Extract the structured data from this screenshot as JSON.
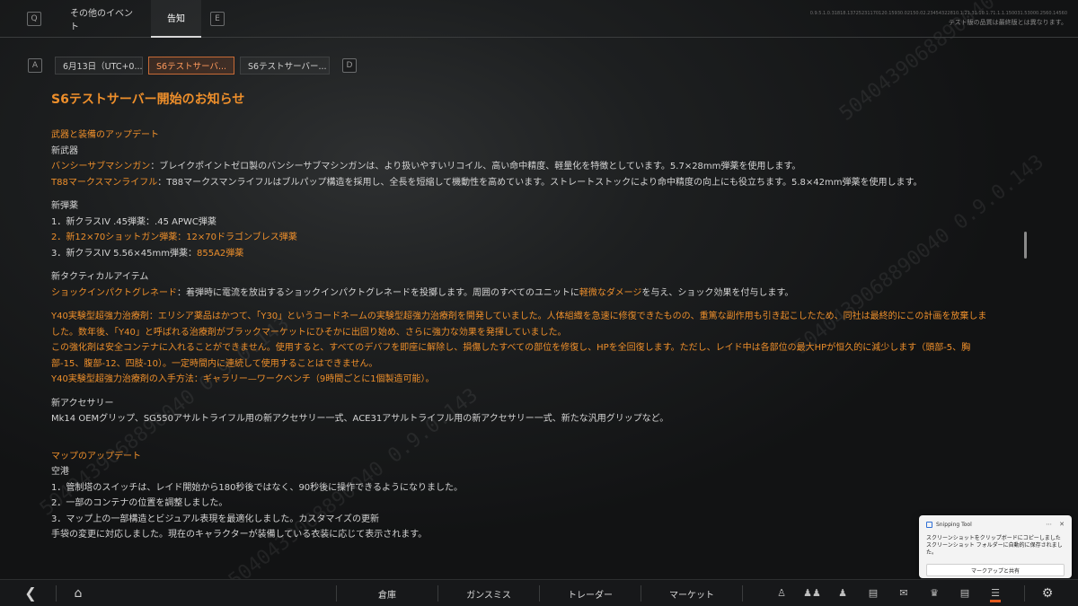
{
  "header": {
    "key_left": "Q",
    "key_right": "E",
    "tabs": [
      {
        "label": "その他のイベント"
      },
      {
        "label": "告知"
      }
    ],
    "note_ids": "0.9.5.1.0.31818.13725231170120.15930.02150.02.23454322810.1.21.31.10.1.71.1.1.150031.53000.2560.14560",
    "note": "テスト版の品質は最終版とは異なります。"
  },
  "subtabs": {
    "key_left": "A",
    "key_right": "D",
    "items": [
      {
        "label": "6月13日（UTC+0..."
      },
      {
        "label": "S6テストサーバ..."
      },
      {
        "label": "S6テストサーバー..."
      }
    ]
  },
  "article": {
    "title": "S6テストサーバー開始のお知らせ",
    "weapons_section": "武器と装備のアップデート",
    "new_weapons_label": "新武器",
    "banshee_name": "バンシーサブマシンガン",
    "banshee_desc": "：ブレイクポイントゼロ製のバンシーサブマシンガンは、より扱いやすいリコイル、高い命中精度、軽量化を特徴としています。5.7×28mm弾薬を使用します。",
    "t88_name": "T88マークスマンライフル",
    "t88_desc": "：T88マークスマンライフルはブルパップ構造を採用し、全長を短縮して機動性を高めています。ストレートストックにより命中精度の向上にも役立ちます。5.8×42mm弾薬を使用します。",
    "ammo_label": "新弾薬",
    "ammo1": "1．新クラスIV .45弾薬：.45 APWC弾薬",
    "ammo2": "2．新12×70ショットガン弾薬：12×70ドラゴンブレス弾薬",
    "ammo3_prefix": "3．新クラスIV 5.56×45mm弾薬：",
    "ammo3_value": "855A2弾薬",
    "tactical_label": "新タクティカルアイテム",
    "shock_name": "ショックインパクトグレネード",
    "shock_desc_1": "：着弾時に電流を放出するショックインパクトグレネードを投擲します。周囲のすべてのユニットに",
    "shock_highlight": "軽微なダメージ",
    "shock_desc_2": "を与え、ショック効果を付与します。",
    "y40_para1": "Y40実験型超強力治療剤：エリシア薬品はかつて、「Y30」というコードネームの実験型超強力治療剤を開発していました。人体組織を急速に修復できたものの、重篤な副作用も引き起こしたため、同社は最終的にこの計画を放棄しました。数年後、「Y40」と呼ばれる治療剤がブラックマーケットにひそかに出回り始め、さらに強力な効果を発揮していました。",
    "y40_para2": "この強化剤は安全コンテナに入れることができません。使用すると、すべてのデバフを即座に解除し、損傷したすべての部位を修復し、HPを全回復します。ただし、レイド中は各部位の最大HPが恒久的に減少します（頭部-5、胸部-15、腹部-12、四肢-10）。一定時間内に連続して使用することはできません。",
    "y40_para3": "Y40実験型超強力治療剤の入手方法：ギャラリー—ワークベンチ（9時間ごとに1個製造可能）。",
    "accessory_label": "新アクセサリー",
    "accessory_desc": "Mk14 OEMグリップ、SG550アサルトライフル用の新アクセサリー一式、ACE31アサルトライフル用の新アクセサリー一式、新たな汎用グリップなど。",
    "map_section": "マップのアップデート",
    "airport_label": "空港",
    "map1": "1．管制塔のスイッチは、レイド開始から180秒後ではなく、90秒後に操作できるようになりました。",
    "map2": "2．一部のコンテナの位置を調整しました。",
    "map3": "3．マップ上の一部構造とビジュアル表現を最適化しました。カスタマイズの更新",
    "map4": "手袋の変更に対応しました。現在のキャラクターが装備している衣装に応じて表示されます。"
  },
  "watermark": "5040439068890040 0.9.0.143",
  "toast": {
    "app": "Snipping Tool",
    "line1": "スクリーンショットをクリップボードにコピーしました",
    "line2": "スクリーンショット フォルダーに自動的に保存されました。",
    "button": "マークアップと共有"
  },
  "bottom": {
    "menu": [
      {
        "label": "倉庫"
      },
      {
        "label": "ガンスミス"
      },
      {
        "label": "トレーダー"
      },
      {
        "label": "マーケット"
      }
    ],
    "icons": [
      "operator-icon",
      "squad-icon",
      "friends-icon",
      "chat-icon",
      "mail-icon",
      "trophy-icon",
      "notes-icon",
      "event-icon"
    ]
  },
  "colors": {
    "accent_orange": "#ee8f2b",
    "active_tab_border": "#c66a36",
    "text": "#d4d4d4"
  }
}
